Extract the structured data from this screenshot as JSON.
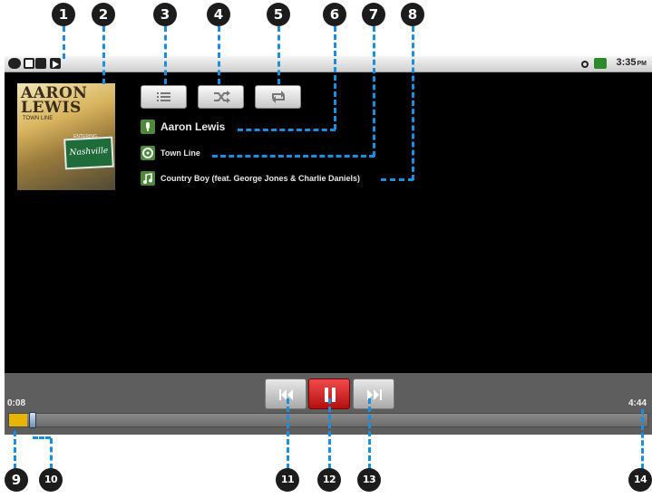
{
  "callouts": [
    "1",
    "2",
    "3",
    "4",
    "5",
    "6",
    "7",
    "8",
    "9",
    "10",
    "11",
    "12",
    "13",
    "14"
  ],
  "status_bar": {
    "time": "3:35",
    "ampm": "PM",
    "left_icons": [
      "usb-icon",
      "sd-card-icon",
      "debug-icon",
      "play-icon"
    ],
    "right_icons": [
      "wifi-icon",
      "battery-icon"
    ]
  },
  "album_art": {
    "artist_text": "AARON\nLEWIS",
    "album_text": "TOWN LINE",
    "sign_text": "Nashville",
    "sign_sub": "ENTERING"
  },
  "controls": {
    "playlist_icon": "playlist-icon",
    "shuffle_icon": "shuffle-icon",
    "repeat_icon": "repeat-icon"
  },
  "track_info": {
    "artist": "Aaron Lewis",
    "album": "Town Line",
    "song": "Country Boy (feat. George Jones & Charlie Daniels)"
  },
  "playback": {
    "elapsed": "0:08",
    "duration": "4:44",
    "progress_fraction": 0.028,
    "prev_icon": "previous-icon",
    "pause_icon": "pause-icon",
    "next_icon": "next-icon"
  },
  "colors": {
    "callout_line": "#1a8fe0",
    "pause_button": "#d92020",
    "progress": "#e7b400"
  }
}
